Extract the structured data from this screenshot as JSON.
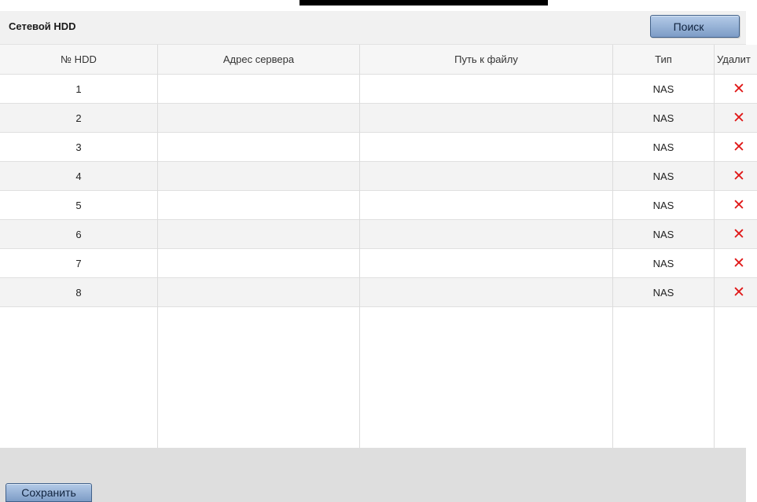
{
  "panel": {
    "title": "Сетевой HDD",
    "search_label": "Поиск",
    "save_label": "Сохранить"
  },
  "table": {
    "columns": [
      "№ HDD",
      "Адрес сервера",
      "Путь к файлу",
      "Тип",
      "Удалит"
    ],
    "rows": [
      {
        "num": "1",
        "server": "",
        "path": "",
        "type": "NAS",
        "delete": "✕"
      },
      {
        "num": "2",
        "server": "",
        "path": "",
        "type": "NAS",
        "delete": "✕"
      },
      {
        "num": "3",
        "server": "",
        "path": "",
        "type": "NAS",
        "delete": "✕"
      },
      {
        "num": "4",
        "server": "",
        "path": "",
        "type": "NAS",
        "delete": "✕"
      },
      {
        "num": "5",
        "server": "",
        "path": "",
        "type": "NAS",
        "delete": "✕"
      },
      {
        "num": "6",
        "server": "",
        "path": "",
        "type": "NAS",
        "delete": "✕"
      },
      {
        "num": "7",
        "server": "",
        "path": "",
        "type": "NAS",
        "delete": "✕"
      },
      {
        "num": "8",
        "server": "",
        "path": "",
        "type": "NAS",
        "delete": "✕"
      }
    ]
  },
  "colors": {
    "delete_icon": "#e01818",
    "button_gradient_top": "#b4cbe8",
    "button_gradient_bottom": "#7d9cc6"
  },
  "icons": {
    "delete": "close-icon"
  }
}
